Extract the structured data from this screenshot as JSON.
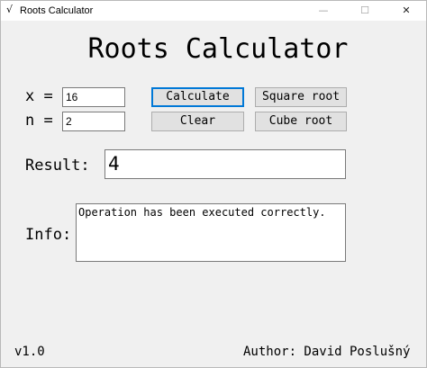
{
  "window": {
    "title": "Roots Calculator",
    "app_icon": "√",
    "minimize_glyph": "—",
    "maximize_glyph": "☐",
    "close_glyph": "✕"
  },
  "main": {
    "title": "Roots Calculator"
  },
  "inputs": {
    "x_label": "x =",
    "x_value": "16",
    "n_label": "n =",
    "n_value": "2"
  },
  "buttons": {
    "calculate": "Calculate",
    "clear": "Clear",
    "square_root": "Square root",
    "cube_root": "Cube root"
  },
  "result": {
    "label": "Result:",
    "value": "4"
  },
  "info": {
    "label": "Info:",
    "text": "Operation has been executed correctly."
  },
  "footer": {
    "version": "v1.0",
    "author": "Author: David Poslušný"
  }
}
